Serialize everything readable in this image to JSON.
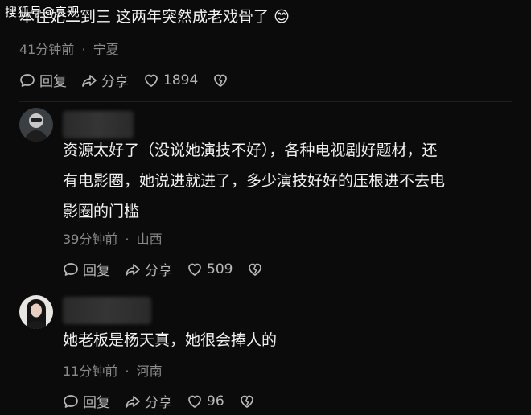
{
  "watermark": "搜狐号@哀观·",
  "comment1": {
    "text": "本住妃二到三 这两年突然成老戏骨了 😊",
    "time": "41分钟前",
    "location": "宁夏",
    "reply_label": "回复",
    "share_label": "分享",
    "likes": "1894"
  },
  "comment2": {
    "lines": [
      "资源太好了（没说她演技不好），各种电视剧好题材，还",
      "有电影圈，她说进就进了，多少演技好好的压根进不去电",
      "影圈的门槛"
    ],
    "time": "39分钟前",
    "location": "山西",
    "reply_label": "回复",
    "share_label": "分享",
    "likes": "509"
  },
  "comment3": {
    "text": "她老板是杨天真，她很会捧人的",
    "time": "11分钟前",
    "location": "河南",
    "reply_label": "回复",
    "share_label": "分享",
    "likes": "96"
  },
  "separator": "·",
  "colors": {
    "background": "#0b0b0b",
    "text": "#f2f2f2",
    "meta": "#8a8a8a",
    "action": "#b9b9b9"
  },
  "icons": [
    "reply-icon",
    "share-icon",
    "heart-icon",
    "dislike-heart-icon"
  ]
}
